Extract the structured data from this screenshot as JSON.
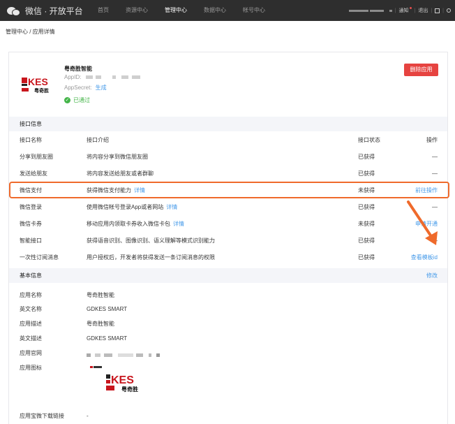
{
  "topbar": {
    "brand": "微信 · 开放平台",
    "nav": [
      "首页",
      "资源中心",
      "管理中心",
      "数据中心",
      "帐号中心"
    ],
    "active_nav": "管理中心",
    "right": {
      "notify": "通知",
      "logout": "退出"
    }
  },
  "breadcrumb": "管理中心 / 应用详情",
  "app": {
    "name": "粤奇胜智能",
    "appid_label": "AppID:",
    "appsecret_label": "AppSecret:",
    "generate_link": "生成",
    "status": "已通过",
    "delete_button": "删除应用",
    "logo_text": "KES",
    "logo_sub": "粤奇胜"
  },
  "interfaces": {
    "section_title": "接口信息",
    "columns": [
      "接口名称",
      "接口介绍",
      "接口状态",
      "操作"
    ],
    "rows": [
      {
        "name": "分享到朋友圈",
        "desc": "将内容分享到微信朋友圈",
        "detail": "",
        "status": "已获得",
        "action": "—",
        "action_link": false
      },
      {
        "name": "发送给朋友",
        "desc": "将内容发送给朋友或者群聊",
        "detail": "",
        "status": "已获得",
        "action": "—",
        "action_link": false
      },
      {
        "name": "微信支付",
        "desc": "获得微信支付能力",
        "detail": "详情",
        "status": "未获得",
        "action": "前往操作",
        "action_link": true
      },
      {
        "name": "微信登录",
        "desc": "使用微信帐号登录App或者网站",
        "detail": "详情",
        "status": "已获得",
        "action": "—",
        "action_link": false
      },
      {
        "name": "微信卡券",
        "desc": "移动应用内领取卡券收入微信卡包",
        "detail": "详情",
        "status": "未获得",
        "action": "申请开通",
        "action_link": true
      },
      {
        "name": "智能接口",
        "desc": "获得语音识别、图像识别、语义理解等模式识别能力",
        "detail": "",
        "status": "已获得",
        "action": "—",
        "action_link": false
      },
      {
        "name": "一次性订阅消息",
        "desc": "用户授权后，开发者将获得发送一条订阅消息的权限",
        "detail": "",
        "status": "已获得",
        "action": "查看模板id",
        "action_link": true
      }
    ]
  },
  "basic": {
    "section_title": "基本信息",
    "edit": "修改",
    "rows": [
      {
        "label": "应用名称",
        "value": "粤奇胜智能"
      },
      {
        "label": "英文名称",
        "value": "GDKES SMART"
      },
      {
        "label": "应用描述",
        "value": "粤奇胜智能"
      },
      {
        "label": "英文描述",
        "value": "GDKES SMART"
      },
      {
        "label": "应用官网",
        "value": ""
      },
      {
        "label": "应用图标",
        "value": ""
      }
    ],
    "download_label": "应用宝微下载链接",
    "download_value": "-"
  },
  "colors": {
    "topbar": "#2e2e2e",
    "link": "#459ae9",
    "danger": "#e64340",
    "success": "#44b549",
    "highlight": "#ef6a2b"
  }
}
